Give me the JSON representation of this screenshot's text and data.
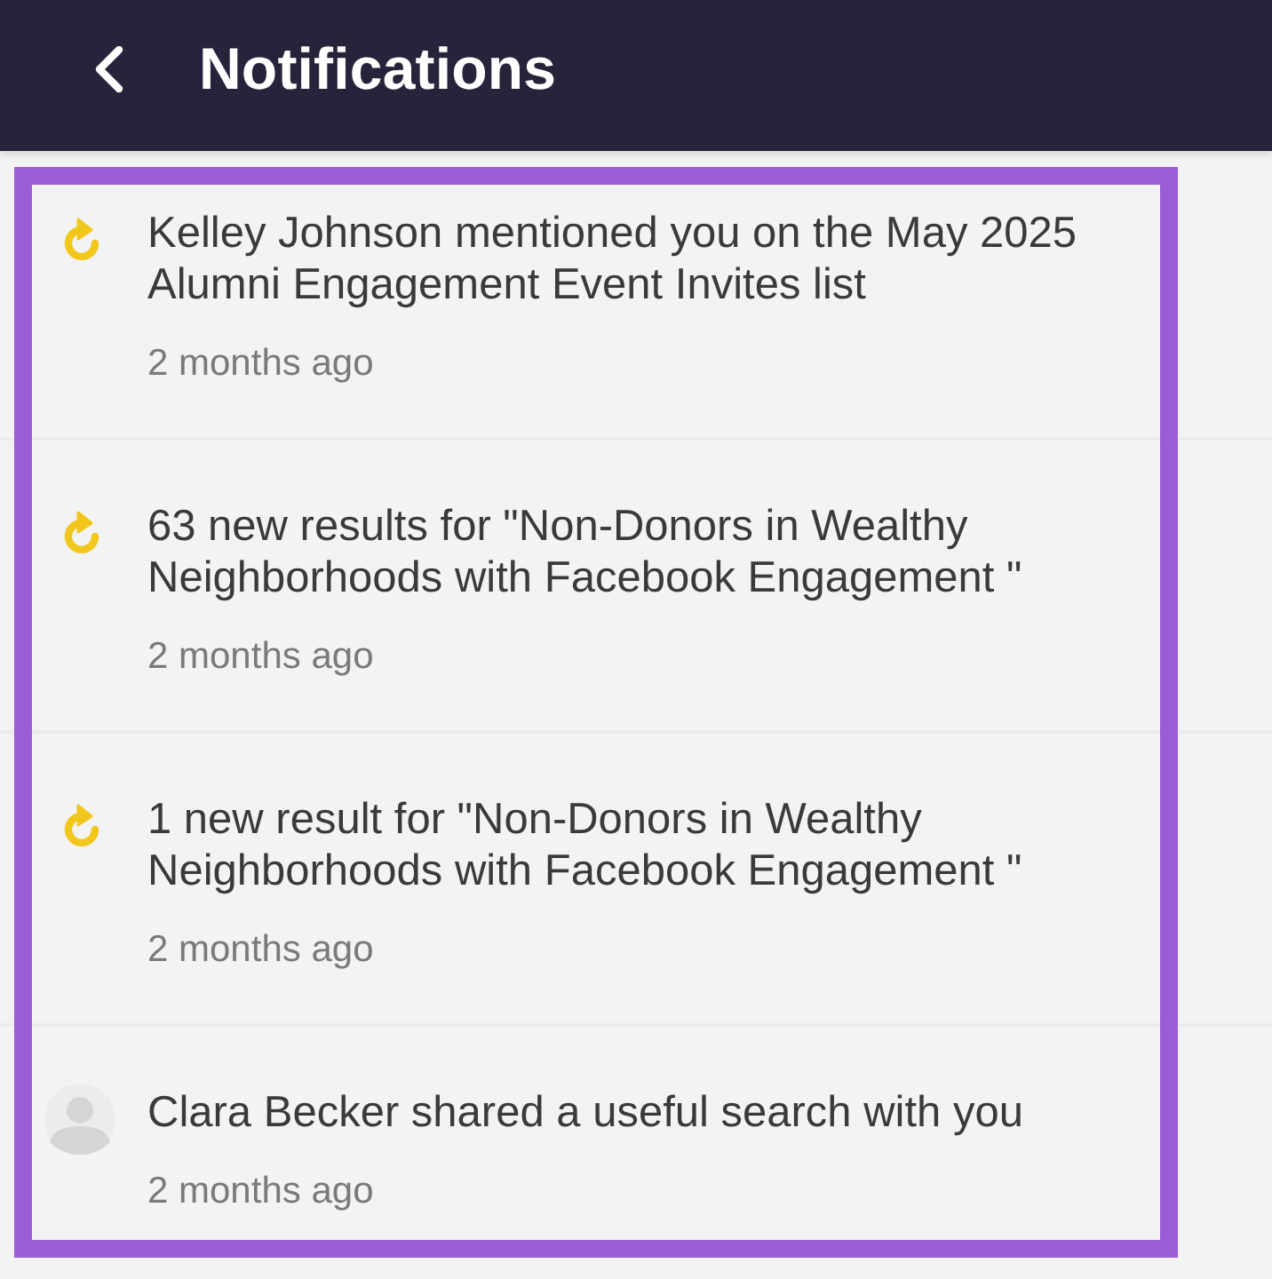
{
  "header": {
    "title": "Notifications"
  },
  "list": {
    "highlighted": true,
    "items": [
      {
        "kind": "update",
        "text": "Kelley Johnson mentioned you on the May 2025 Alumni Engagement Event Invites list",
        "time": "2 months ago"
      },
      {
        "kind": "update",
        "text": "63 new results for \"Non-Donors in Wealthy Neighborhoods with Facebook Engagement \"",
        "time": "2 months ago"
      },
      {
        "kind": "update",
        "text": "1 new result for \"Non-Donors in Wealthy Neighborhoods with Facebook Engagement \"",
        "time": "2 months ago"
      },
      {
        "kind": "share",
        "text": "Clara Becker shared a useful search with you",
        "time": "2 months ago"
      }
    ]
  }
}
